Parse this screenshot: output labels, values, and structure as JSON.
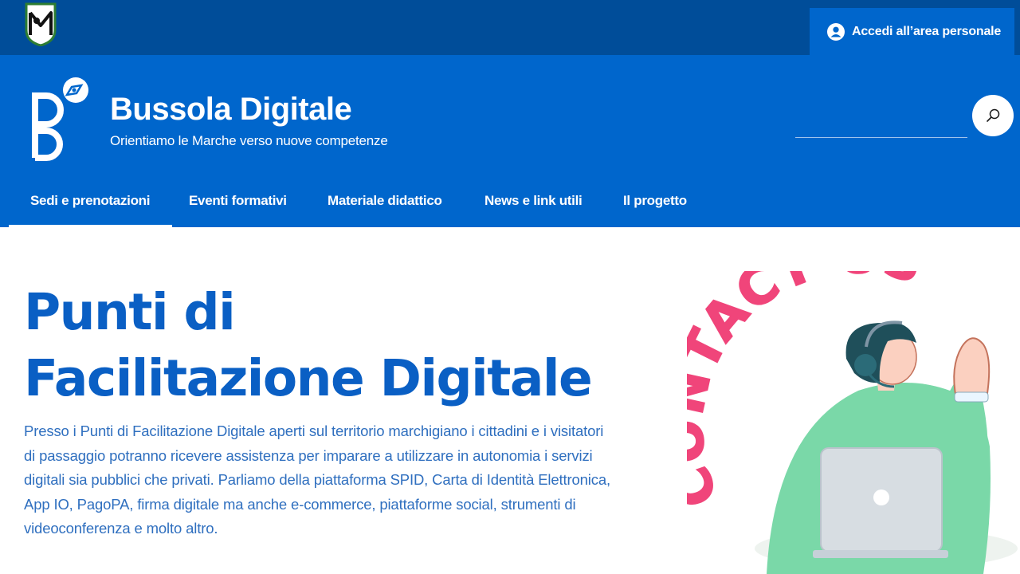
{
  "topbar": {
    "logo_icon": "regione-marche-logo",
    "login_label": "Accedi all’area personale",
    "login_icon": "user-circle-icon"
  },
  "header": {
    "logo_icon": "bussola-digitale-logo",
    "title": "Bussola Digitale",
    "tagline": "Orientiamo le Marche verso nuove competenze",
    "search_icon": "search-icon"
  },
  "nav": {
    "items": [
      {
        "label": "Sedi e prenotazioni",
        "active": true
      },
      {
        "label": "Eventi formativi",
        "active": false
      },
      {
        "label": "Materiale didattico",
        "active": false
      },
      {
        "label": "News e link utili",
        "active": false
      },
      {
        "label": "Il progetto",
        "active": false
      }
    ]
  },
  "hero": {
    "title_line1": "Punti di",
    "title_line2": "Facilitazione Digitale",
    "description": "Presso i Punti di Facilitazione Digitale aperti sul territorio marchigiano i cittadini e i visitatori di passaggio potranno ricevere assistenza per imparare a utilizzare in autonomia i servizi digitali sia pubblici che privati. Parliamo della piattaforma SPID, Carta di Identità Elettronica, App IO, PagoPA, firma digitale ma anche e-commerce, piattaforme social, strumenti di videoconferenza e molto altro.",
    "illustration_text": "CONTACT US"
  },
  "colors": {
    "topbar": "#004d99",
    "header": "#0066cc",
    "hero_title": "#0a5fc4",
    "hero_text": "#2f6fbf",
    "illustration_lettering": "#f0457a",
    "illustration_sweater": "#7ad8a8"
  }
}
